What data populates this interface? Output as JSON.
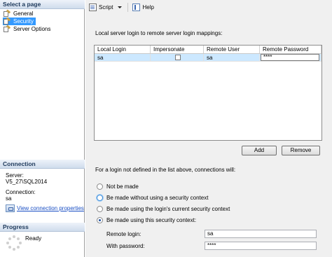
{
  "left": {
    "select_page_header": "Select a page",
    "pages": [
      {
        "label": "General",
        "selected": false
      },
      {
        "label": "Security",
        "selected": true
      },
      {
        "label": "Server Options",
        "selected": false
      }
    ],
    "connection_header": "Connection",
    "server_label": "Server:",
    "server_value": "V5_27\\SQL2014",
    "connection_label": "Connection:",
    "connection_value": "sa",
    "view_connection_link": "View connection properties",
    "progress_header": "Progress",
    "progress_status": "Ready"
  },
  "toolbar": {
    "script_label": "Script",
    "help_label": "Help"
  },
  "main": {
    "mapping_description": "Local server login to remote server login mappings:",
    "grid": {
      "columns": [
        "Local Login",
        "Impersonate",
        "Remote User",
        "Remote Password"
      ],
      "rows": [
        {
          "local_login": "sa",
          "impersonate": false,
          "remote_user": "sa",
          "remote_password": "****"
        }
      ]
    },
    "add_button": "Add",
    "remove_button": "Remove",
    "undefined_login_text": "For a login not defined in the list above, connections will:",
    "options": [
      {
        "label": "Not be made",
        "checked": false
      },
      {
        "label": "Be made without using a security context",
        "checked": false
      },
      {
        "label": "Be made using the login's current security context",
        "checked": false
      },
      {
        "label": "Be made using this security context:",
        "checked": true
      }
    ],
    "remote_login_label": "Remote login:",
    "remote_login_value": "sa",
    "with_password_label": "With password:",
    "with_password_value": "****"
  },
  "colors": {
    "selection": "#3399ff",
    "grid_row_highlight": "#cce8ff",
    "link": "#1a4fc4"
  }
}
